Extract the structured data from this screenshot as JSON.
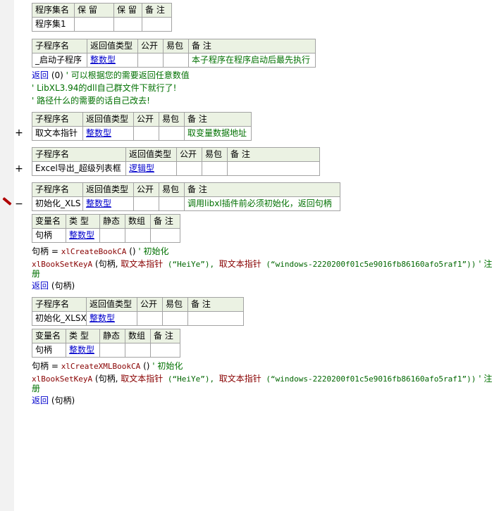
{
  "assembly_table": {
    "headers": [
      "程序集名",
      "保 留",
      "保 留",
      "备 注"
    ],
    "row": [
      "程序集1",
      "",
      "",
      ""
    ]
  },
  "subprograms": [
    {
      "headers": [
        "子程序名",
        "返回值类型",
        "公开",
        "易包",
        "备 注"
      ],
      "name": "_启动子程序",
      "return_type": "整数型",
      "public": "",
      "easy": "",
      "note": "本子程序在程序启动后最先执行"
    },
    {
      "headers": [
        "子程序名",
        "返回值类型",
        "公开",
        "易包",
        "备 注"
      ],
      "name": "取文本指针",
      "return_type": "整数型",
      "public": "",
      "easy": "",
      "note": "取变量数据地址"
    },
    {
      "headers": [
        "子程序名",
        "返回值类型",
        "公开",
        "易包",
        "备 注"
      ],
      "name": "Excel导出_超级列表框",
      "return_type": "逻辑型",
      "public": "",
      "easy": "",
      "note": ""
    },
    {
      "headers": [
        "子程序名",
        "返回值类型",
        "公开",
        "易包",
        "备 注"
      ],
      "name": "初始化_XLS",
      "return_type": "整数型",
      "public": "",
      "easy": "",
      "note": "调用libxl插件前必须初始化，返回句柄"
    },
    {
      "headers": [
        "子程序名",
        "返回值类型",
        "公开",
        "易包",
        "备 注"
      ],
      "name": "初始化_XLSX",
      "return_type": "整数型",
      "public": "",
      "easy": "",
      "note": ""
    }
  ],
  "var_tables": [
    {
      "headers": [
        "变量名",
        "类 型",
        "静态",
        "数组",
        "备 注"
      ],
      "name": "句柄",
      "type": "整数型"
    },
    {
      "headers": [
        "变量名",
        "类 型",
        "静态",
        "数组",
        "备 注"
      ],
      "name": "句柄",
      "type": "整数型"
    }
  ],
  "code": {
    "start_return": {
      "kw": "返回",
      "args": " (0)",
      "comment": "  ' 可以根据您的需要返回任意数值"
    },
    "start_comment1": "' LibXL3.94的dll自己群文件下就行了!",
    "start_comment2": "' 路径什么的需要的话自己改去!",
    "xls_assign": {
      "lhs": "句柄 = ",
      "call": "xlCreateBookCA",
      "rest": " ()",
      "comment": "  ' 初始化"
    },
    "xls_setkey": {
      "call": "xlBookSetKeyA",
      "p1": " (句柄, ",
      "fn1": "取文本指针",
      "s1": " (“HeiYe”), ",
      "fn2": "取文本指针",
      "s2": " (“windows-2220200f01c5e9016fb86160afo5raf1”))",
      "comment": "  ' 注",
      "wrap": "册"
    },
    "xls_return": {
      "kw": "返回",
      "args": " (句柄)"
    },
    "xlsx_assign": {
      "lhs": "句柄 = ",
      "call": "xlCreateXMLBookCA",
      "rest": " ()",
      "comment": "  ' 初始化"
    },
    "xlsx_setkey": {
      "call": "xlBookSetKeyA",
      "p1": " (句柄, ",
      "fn1": "取文本指针",
      "s1": " (“HeiYe”), ",
      "fn2": "取文本指针",
      "s2": " (“windows-2220200f01c5e9016fb86160afo5raf1”))",
      "comment": "  ' 注",
      "wrap": "册"
    },
    "xlsx_return": {
      "kw": "返回",
      "args": " (句柄)"
    }
  },
  "gutter": {
    "expand_plus": "+",
    "collapse_minus": "−"
  }
}
